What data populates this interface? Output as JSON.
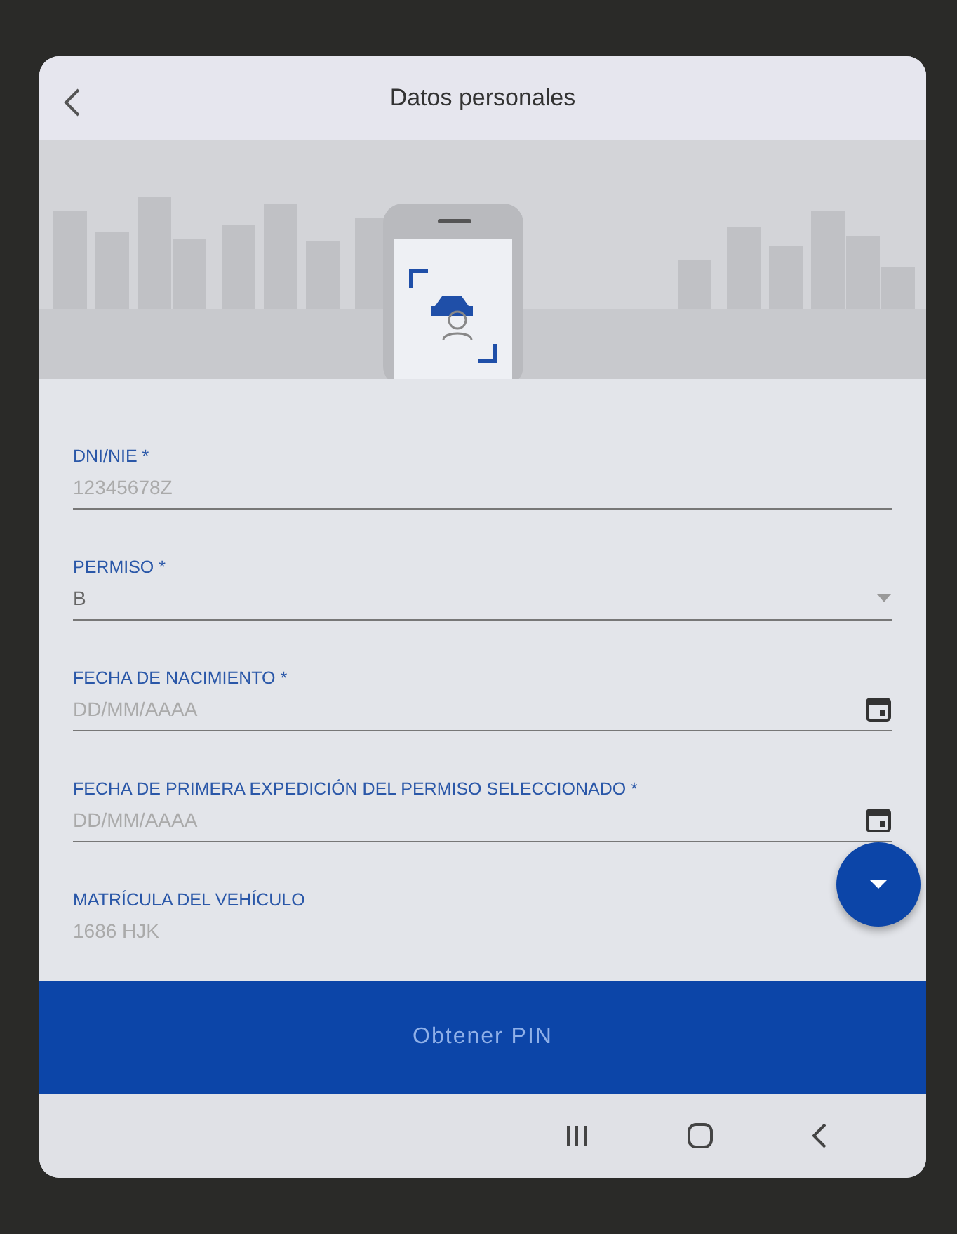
{
  "header": {
    "title": "Datos personales"
  },
  "fields": [
    {
      "kind": "text",
      "label": "DNI/NIE *",
      "placeholder": "12345678Z"
    },
    {
      "kind": "select",
      "label": "PERMISO *",
      "value": "B"
    },
    {
      "kind": "date",
      "label": "FECHA DE NACIMIENTO *",
      "placeholder": "DD/MM/AAAA"
    },
    {
      "kind": "date",
      "label": "FECHA DE PRIMERA EXPEDICIÓN DEL PERMISO SELECCIONADO *",
      "placeholder": "DD/MM/AAAA"
    },
    {
      "kind": "text",
      "label": "MATRÍCULA DEL VEHÍCULO",
      "placeholder": "1686 HJK"
    }
  ],
  "submit_button": "Obtener PIN"
}
